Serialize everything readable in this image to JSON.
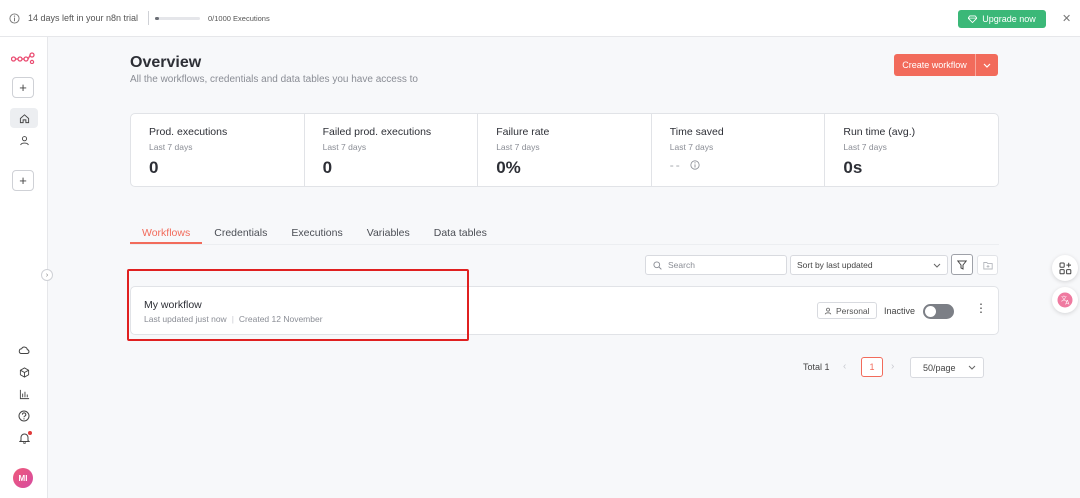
{
  "banner": {
    "trial_text": "14 days left in your n8n trial",
    "executions_text": "0/1000 Executions",
    "executions_fraction": 0.0,
    "upgrade_label": "Upgrade now"
  },
  "header": {
    "title": "Overview",
    "subtitle": "All the workflows, credentials and data tables you have access to",
    "create_label": "Create workflow"
  },
  "stats": [
    {
      "label": "Prod. executions",
      "period": "Last 7 days",
      "value": "0"
    },
    {
      "label": "Failed prod. executions",
      "period": "Last 7 days",
      "value": "0"
    },
    {
      "label": "Failure rate",
      "period": "Last 7 days",
      "value": "0%"
    },
    {
      "label": "Time saved",
      "period": "Last 7 days",
      "value": "--"
    },
    {
      "label": "Run time (avg.)",
      "period": "Last 7 days",
      "value": "0s"
    }
  ],
  "tabs": [
    {
      "label": "Workflows",
      "active": true
    },
    {
      "label": "Credentials",
      "active": false
    },
    {
      "label": "Executions",
      "active": false
    },
    {
      "label": "Variables",
      "active": false
    },
    {
      "label": "Data tables",
      "active": false
    }
  ],
  "toolbar": {
    "search_placeholder": "Search",
    "sort_label": "Sort by last updated"
  },
  "workflow": {
    "name": "My workflow",
    "updated": "Last updated just now",
    "created": "Created 12 November",
    "owner_badge": "Personal",
    "status_label": "Inactive",
    "active": false
  },
  "pagination": {
    "total_label": "Total 1",
    "current_page": "1",
    "per_page": "50/page"
  },
  "user": {
    "initials": "MI"
  },
  "colors": {
    "accent": "#f26b5b",
    "upgrade": "#3bb878",
    "highlight": "#e02020"
  }
}
